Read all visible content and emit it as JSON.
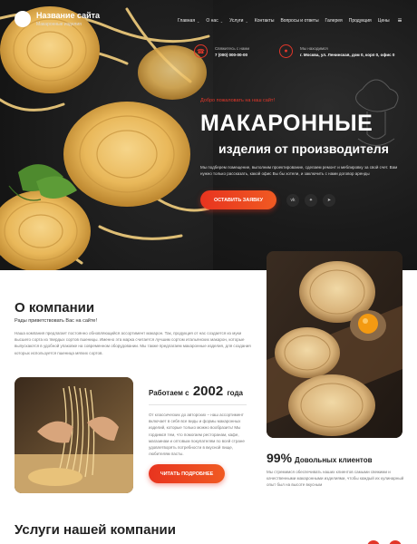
{
  "header": {
    "site_name": "Название сайта",
    "tagline": "Макаронные изделия",
    "nav": [
      {
        "label": "Главная",
        "dropdown": true
      },
      {
        "label": "О нас",
        "dropdown": true
      },
      {
        "label": "Услуги",
        "dropdown": true
      },
      {
        "label": "Контакты",
        "dropdown": false
      },
      {
        "label": "Вопросы и ответы",
        "dropdown": false
      },
      {
        "label": "Галерея",
        "dropdown": false
      },
      {
        "label": "Продукция",
        "dropdown": false
      },
      {
        "label": "Цены",
        "dropdown": false
      }
    ],
    "menu_icon": "hamburger-icon"
  },
  "contacts": {
    "phone_label": "Свяжитесь с нами",
    "phone": "7 (000) 000-00-00",
    "address_label": "Мы находимся",
    "address": "г. Москва, ул. Ленинская, дом 0, корп 0, офис 0"
  },
  "hero": {
    "welcome": "Добро пожаловать на наш сайт!",
    "title": "МАКАРОННЫЕ",
    "subtitle": "изделия от производителя",
    "description": "Мы подберем помещение, выполним проектирование, сделаем ремонт и меблировку за свой счет. Вам нужно только рассказать, какой офис Вы бы хотели, и заключить с нами договор аренды",
    "cta": "ОСТАВИТЬ ЗАЯВКУ",
    "socials": [
      "vk-icon",
      "twitter-icon",
      "telegram-icon"
    ]
  },
  "about": {
    "title": "О компании",
    "greeting": "Рады приветствовать Вас на сайте!",
    "text": "Наша компания предлагает постоянно обновляющийся ассортимент макарон. Так, продукция от нас создается из муки высшего сорта из твердых сортов пшеницы. Именно эта марка считается лучшим сортом итальянских макарон, которые выпускаются в удобной упаковке на современном оборудовании. Мы также предлагаем макаронные изделия, для создания которых используется пшеница мягких сортов."
  },
  "since": {
    "prefix": "Работаем с",
    "year": "2002",
    "suffix": "года",
    "text": "От классических до авторских – наш ассортимент включает в себя все виды и формы макаронных изделий, которые только можно вообразить! Мы гордимся тем, что помогаем ресторанам, кафе, магазинам и оптовым покупателям по всей стране удовлетворять потребности в вкусной пище, любителям пасты.",
    "button": "ЧИТАТЬ ПОДРОБНЕЕ"
  },
  "stat": {
    "number": "99%",
    "label": "Довольных клиентов",
    "text": "Мы стремимся обеспечивать наших клиентов самыми свежими и качественными макаронными изделиями, чтобы каждый их кулинарный опыт был на высоте вкусным"
  },
  "services": {
    "title": "Услуги нашей компании"
  },
  "colors": {
    "accent": "#e2372a",
    "hero_bg": "#1b1b1b",
    "text_dark": "#222222",
    "text_muted": "#777777"
  }
}
